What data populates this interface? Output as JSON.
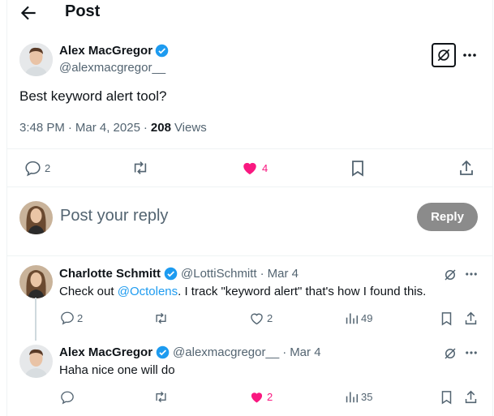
{
  "header": {
    "title": "Post"
  },
  "post": {
    "author": "Alex MacGregor",
    "handle": "@alexmacgregor__",
    "text": "Best keyword alert tool?",
    "time": "3:48 PM",
    "date": "Mar 4, 2025",
    "views_count": "208",
    "views_label": "Views",
    "replies": "2",
    "likes": "4",
    "dot": "·"
  },
  "composer": {
    "placeholder": "Post your reply",
    "reply_label": "Reply"
  },
  "replies": [
    {
      "author": "Charlotte Schmitt",
      "handle": "@LottiSchmitt",
      "date": "Mar 4",
      "text_before": "Check out ",
      "mention": "@Octolens",
      "text_after": ". I track \"keyword alert\" that's how I found this.",
      "replies": "2",
      "likes": "2",
      "views": "49"
    },
    {
      "author": "Alex MacGregor",
      "handle": "@alexmacgregor__",
      "date": "Mar 4",
      "text": "Haha nice one will do",
      "replies": "",
      "likes": "2",
      "views": "35"
    }
  ],
  "colors": {
    "verified": "#1d9bf0",
    "like": "#f91880",
    "reply_button": "#8b8b8b",
    "muted": "#536471"
  },
  "icons": [
    "back-arrow-icon",
    "verified-icon",
    "grok-icon",
    "more-icon",
    "reply-icon",
    "repost-icon",
    "heart-icon",
    "bookmark-icon",
    "share-icon",
    "views-icon"
  ]
}
